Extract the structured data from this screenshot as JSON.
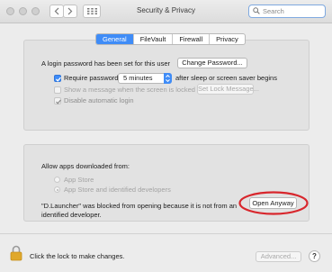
{
  "window": {
    "title": "Security & Privacy"
  },
  "search": {
    "placeholder": "Search"
  },
  "tabs": [
    {
      "label": "General",
      "active": true
    },
    {
      "label": "FileVault",
      "active": false
    },
    {
      "label": "Firewall",
      "active": false
    },
    {
      "label": "Privacy",
      "active": false
    }
  ],
  "general": {
    "login_password_text": "A login password has been set for this user",
    "change_password_label": "Change Password...",
    "require_password": {
      "label": "Require password",
      "checked": true
    },
    "require_password_interval": "5 minutes",
    "require_password_suffix": "after sleep or screen saver begins",
    "show_message": {
      "label": "Show a message when the screen is locked",
      "checked": false
    },
    "set_lock_message_label": "Set Lock Message...",
    "disable_auto_login": {
      "label": "Disable automatic login",
      "checked": true
    }
  },
  "allow_apps": {
    "heading": "Allow apps downloaded from:",
    "options": [
      {
        "label": "App Store",
        "selected": false
      },
      {
        "label": "App Store and identified developers",
        "selected": true
      }
    ],
    "blocked_message_line1": "\"D.Launcher\" was blocked from opening because it is not from an",
    "blocked_message_line2": "identified developer.",
    "open_anyway_label": "Open Anyway",
    "highlight_color": "#d8262c"
  },
  "footer": {
    "lock_text": "Click the lock to make changes.",
    "advanced_label": "Advanced...",
    "help_label": "?"
  },
  "colors": {
    "accent": "#3f8cf7",
    "window_bg": "#ececec",
    "lock": "#e0a82b"
  },
  "icons": [
    "back-chevron-icon",
    "forward-chevron-icon",
    "grid-icon",
    "search-icon",
    "checkmark-icon",
    "lock-icon",
    "popup-arrows-icon"
  ]
}
